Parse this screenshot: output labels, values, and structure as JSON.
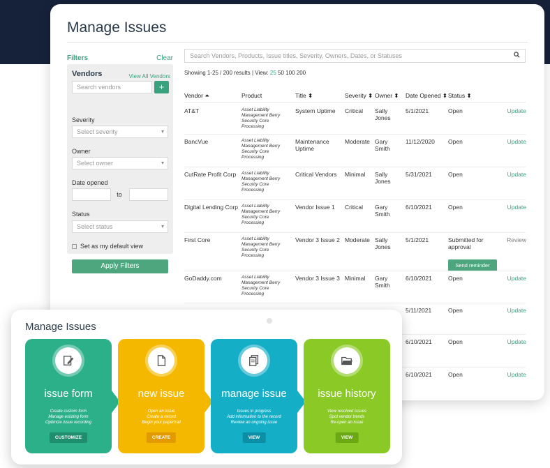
{
  "page": {
    "title": "Manage Issues"
  },
  "filters": {
    "label": "Filters",
    "clear": "Clear",
    "vendors_title": "Vendors",
    "view_all": "View All Vendors",
    "vendor_search_placeholder": "Search vendors",
    "add_symbol": "+",
    "severity_label": "Severity",
    "severity_placeholder": "Select severity",
    "owner_label": "Owner",
    "owner_placeholder": "Select owner",
    "date_label": "Date opened",
    "date_to": "to",
    "status_label": "Status",
    "status_placeholder": "Select status",
    "default_view": "Set as my default view",
    "apply": "Apply Filters"
  },
  "search": {
    "placeholder": "Search Vendors, Products, Issue titles, Severity, Owners, Dates, or Statuses",
    "icon": "search-icon"
  },
  "results": {
    "showing": "Showing 1-25 / 200 results | View:",
    "view_25": "25",
    "view_50": "50",
    "view_100": "100",
    "view_200": "200"
  },
  "table": {
    "headers": [
      "Vendor ⏶",
      "Product",
      "Title ⬍",
      "Severity ⬍",
      "Owner ⬍",
      "Date Opened ⬍",
      "Status ⬍"
    ],
    "rows": [
      {
        "vendor": "AT&T",
        "product": "Asset Liability Management Berry Security Core Processing",
        "title": "System Uptime",
        "severity": "Critical",
        "owner": "Sally Jones",
        "date": "5/1/2021",
        "status": "Open",
        "action": "Update"
      },
      {
        "vendor": "BancVue",
        "product": "Asset Liability Management Berry Security Core Processing",
        "title": "Maintenance Uptime",
        "severity": "Moderate",
        "owner": "Gary Smith",
        "date": "11/12/2020",
        "status": "Open",
        "action": "Update"
      },
      {
        "vendor": "CutRate Profit Corp",
        "product": "Asset Liability Management Berry Security Core Processing",
        "title": "Critical Vendors",
        "severity": "Minimal",
        "owner": "Sally Jones",
        "date": "5/31/2021",
        "status": "Open",
        "action": "Update"
      },
      {
        "vendor": "Digital Lending Corp",
        "product": "Asset Liability Management Berry Security Core Processing",
        "title": "Vendor Issue 1",
        "severity": "Critical",
        "owner": "Gary Smith",
        "date": "6/10/2021",
        "status": "Open",
        "action": "Update"
      },
      {
        "vendor": "First Core",
        "product": "Asset Liability Management Berry Security Core Processing",
        "title": "Vendor 3 Issue 2",
        "severity": "Moderate",
        "owner": "Sally Jones",
        "date": "5/1/2021",
        "status": "Submitted for approval",
        "action": "Review",
        "reminder": "Send reminder"
      },
      {
        "vendor": "GoDaddy.com",
        "product": "Asset Liability Management Berry Security Core Processing",
        "title": "Vendor 3 Issue 3",
        "severity": "Minimal",
        "owner": "Gary Smith",
        "date": "6/10/2021",
        "status": "Open",
        "action": "Update"
      },
      {
        "vendor": "",
        "product": "",
        "title": "",
        "severity": "",
        "owner": "",
        "date": "5/11/2021",
        "status": "Open",
        "action": "Update"
      },
      {
        "vendor": "",
        "product": "",
        "title": "",
        "severity": "",
        "owner": "",
        "date": "6/10/2021",
        "status": "Open",
        "action": "Update"
      },
      {
        "vendor": "",
        "product": "",
        "title": "",
        "severity": "",
        "owner": "",
        "date": "6/10/2021",
        "status": "Open",
        "action": "Update"
      }
    ]
  },
  "workflow": {
    "title": "Manage Issues",
    "steps": [
      {
        "name": "issue form",
        "lines": [
          "Create custom form",
          "Manage existing form",
          "Optimize issue recording"
        ],
        "button": "CUSTOMIZE",
        "color": "#2bb08a",
        "btn_color": "#1e8e6e",
        "icon": "edit-form-icon"
      },
      {
        "name": "new issue",
        "lines": [
          "Open an issue",
          "Create a record",
          "Begin your papertrail"
        ],
        "button": "CREATE",
        "color": "#f5b800",
        "btn_color": "#e39a00",
        "icon": "new-document-icon"
      },
      {
        "name": "manage issue",
        "lines": [
          "Issues in progress",
          "Add information to the record",
          "Review an ongoing issue"
        ],
        "button": "VIEW",
        "color": "#14aec7",
        "btn_color": "#0c8ea4",
        "icon": "documents-icon"
      },
      {
        "name": "issue history",
        "lines": [
          "View resolved issues",
          "Spot vendor trends",
          "Re-open an issue"
        ],
        "button": "VIEW",
        "color": "#8ac926",
        "btn_color": "#6aa815",
        "icon": "open-folder-icon"
      }
    ]
  },
  "colors": {
    "accent": "#3aa17e",
    "header_bg": "#16223a"
  }
}
